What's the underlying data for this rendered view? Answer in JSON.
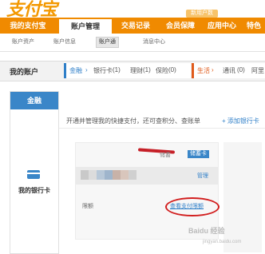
{
  "logo": "支付宝",
  "promo_badge": "新用户数",
  "mainnav": [
    "我的支付宝",
    "账户管理",
    "交易记录",
    "会员保障",
    "应用中心",
    "特色"
  ],
  "subnav": [
    "账户资产",
    "账户信息",
    "账户通",
    "消息中心"
  ],
  "account_bar": {
    "title": "我的账户",
    "finance": "金融",
    "bank_card": "银行卡",
    "bank_card_count": "(1)",
    "wealth": "理财",
    "wealth_count": "(1)",
    "insurance": "保险",
    "insurance_count": "(0)",
    "life": "生活",
    "telecom": "通讯",
    "telecom_count": "(0)",
    "ali": "阿里"
  },
  "side": {
    "header": "金融",
    "label": "我的银行卡"
  },
  "content": {
    "info_text": "开通并管理我的快捷支付，还可查积分、查账单",
    "add_card": "+ 添加银行卡",
    "savings_label": "储蓄",
    "savings_badge": "储蓄卡",
    "manage": "管理",
    "limit_label": "限额",
    "limit_link": "查看支付限额"
  },
  "watermark": "Baidu 经验",
  "watermark_url": "jingyan.baidu.com",
  "colors": {
    "orange": "#f08a00",
    "blue": "#3a86c8",
    "red": "#d21f1f"
  }
}
